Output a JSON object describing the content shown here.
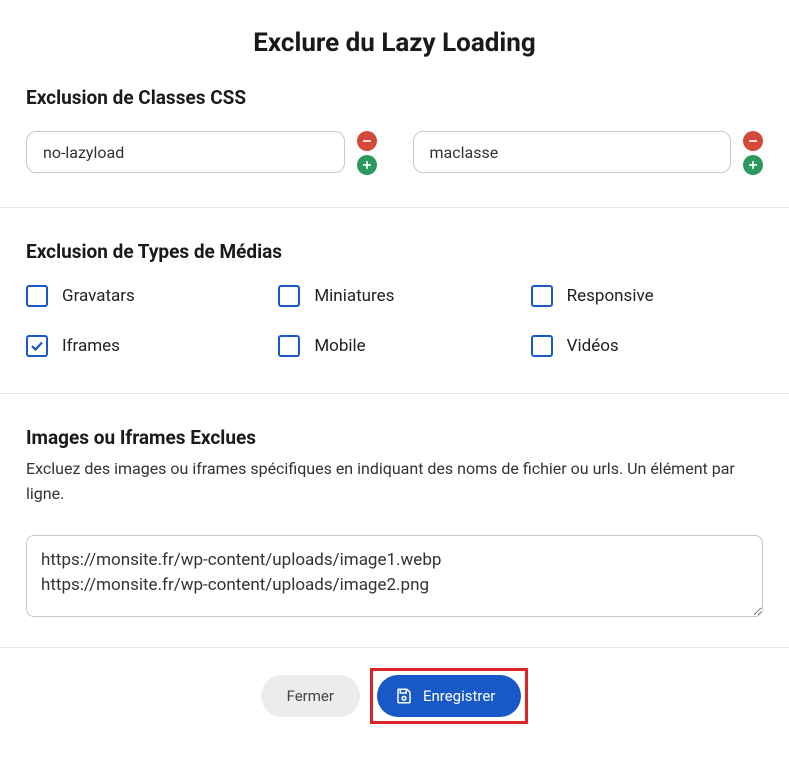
{
  "title": "Exclure du Lazy Loading",
  "css_exclusion": {
    "heading": "Exclusion de Classes CSS",
    "inputs": [
      {
        "value": "no-lazyload"
      },
      {
        "value": "maclasse"
      }
    ]
  },
  "media_exclusion": {
    "heading": "Exclusion de Types de Médias",
    "items": [
      {
        "label": "Gravatars",
        "checked": false
      },
      {
        "label": "Miniatures",
        "checked": false
      },
      {
        "label": "Responsive",
        "checked": false
      },
      {
        "label": "Iframes",
        "checked": true
      },
      {
        "label": "Mobile",
        "checked": false
      },
      {
        "label": "Vidéos",
        "checked": false
      }
    ]
  },
  "excluded_images": {
    "heading": "Images ou Iframes Exclues",
    "description": "Excluez des images ou iframes spécifiques en indiquant des noms de fichier ou urls. Un élément par ligne.",
    "value": "https://monsite.fr/wp-content/uploads/image1.webp\nhttps://monsite.fr/wp-content/uploads/image2.png"
  },
  "footer": {
    "close_label": "Fermer",
    "save_label": "Enregistrer"
  }
}
